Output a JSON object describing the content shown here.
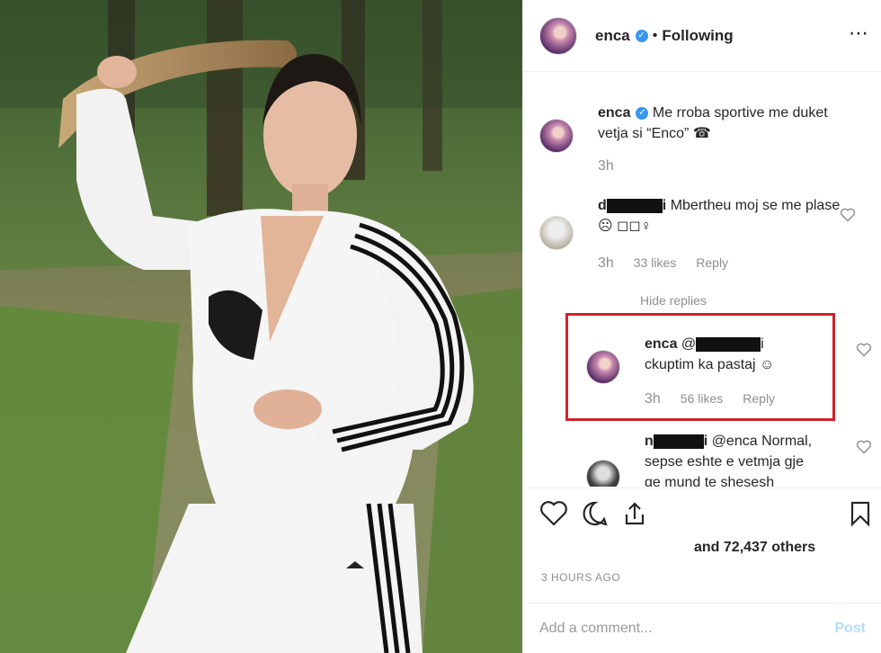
{
  "header": {
    "username": "enca",
    "separator": "•",
    "follow_status": "Following",
    "more_icon": "⋯"
  },
  "caption": {
    "username": "enca",
    "text": "Me rroba sportive me duket vetja si “Enco” ☎",
    "time": "3h"
  },
  "comments": [
    {
      "username_visible": "d",
      "username_suffix": "i",
      "text": "Mbertheu moj se me plase ☹ ◻◻♀",
      "time": "3h",
      "likes": "33 likes",
      "reply": "Reply"
    }
  ],
  "hide_replies": "Hide replies",
  "replies": [
    {
      "username": "enca",
      "mention_prefix": "@",
      "mention_suffix": "i",
      "text": "ckuptim ka pastaj ☺",
      "time": "3h",
      "likes": "56 likes",
      "reply": "Reply"
    },
    {
      "username_visible": "n",
      "username_suffix": "i",
      "text": "@enca Normal, sepse eshte e vetmja gje qe mund te shesesh"
    }
  ],
  "actions": {
    "likes_text": "and 72,437 others",
    "time_ago": "3 HOURS AGO"
  },
  "add_comment": {
    "placeholder": "Add a comment...",
    "post_label": "Post"
  },
  "colors": {
    "verified": "#3897f0",
    "highlight_border": "#d0232a",
    "post_disabled": "#b3dbff"
  },
  "icons": [
    "heart-icon",
    "comment-icon",
    "share-icon",
    "bookmark-icon",
    "more-options-icon",
    "verified-badge-icon"
  ]
}
